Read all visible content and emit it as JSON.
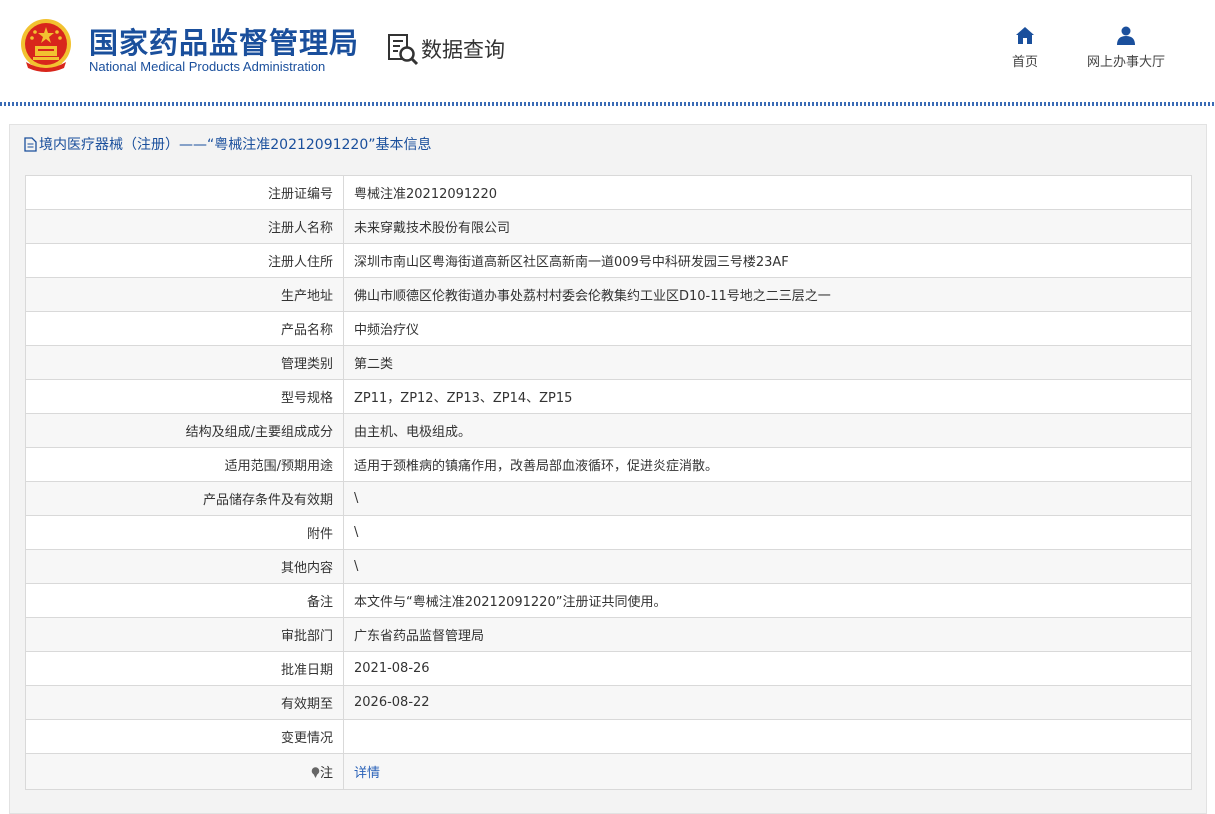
{
  "header": {
    "org_name_cn": "国家药品监督管理局",
    "org_name_en": "National Medical Products Administration",
    "section_title": "数据查询",
    "nav": [
      {
        "label": "首页",
        "icon": "home-icon"
      },
      {
        "label": "网上办事大厅",
        "icon": "user-icon"
      }
    ]
  },
  "panel": {
    "title": "境内医疗器械（注册）——“粤械注准20212091220”基本信息"
  },
  "table": {
    "rows": [
      {
        "label": "注册证编号",
        "value": "粤械注准20212091220"
      },
      {
        "label": "注册人名称",
        "value": "未来穿戴技术股份有限公司"
      },
      {
        "label": "注册人住所",
        "value": "深圳市南山区粤海街道高新区社区高新南一道009号中科研发园三号楼23AF"
      },
      {
        "label": "生产地址",
        "value": "佛山市顺德区伦教街道办事处荔村村委会伦教集约工业区D10-11号地之二三层之一"
      },
      {
        "label": "产品名称",
        "value": "中频治疗仪"
      },
      {
        "label": "管理类别",
        "value": "第二类"
      },
      {
        "label": "型号规格",
        "value": "ZP11，ZP12、ZP13、ZP14、ZP15"
      },
      {
        "label": "结构及组成/主要组成成分",
        "value": "由主机、电极组成。"
      },
      {
        "label": "适用范围/预期用途",
        "value": "适用于颈椎病的镇痛作用，改善局部血液循环，促进炎症消散。"
      },
      {
        "label": "产品储存条件及有效期",
        "value": "\\"
      },
      {
        "label": "附件",
        "value": "\\"
      },
      {
        "label": "其他内容",
        "value": "\\"
      },
      {
        "label": "备注",
        "value": "本文件与“粤械注准20212091220”注册证共同使用。"
      },
      {
        "label": "审批部门",
        "value": "广东省药品监督管理局"
      },
      {
        "label": "批准日期",
        "value": "2021-08-26"
      },
      {
        "label": "有效期至",
        "value": "2026-08-22"
      },
      {
        "label": "变更情况",
        "value": ""
      }
    ],
    "note_label": "注",
    "note_link": "详情"
  },
  "colors": {
    "brand_blue": "#1a4f9c",
    "link_blue": "#2a62b8",
    "emblem_red": "#d8261c",
    "emblem_gold": "#f2c230"
  }
}
